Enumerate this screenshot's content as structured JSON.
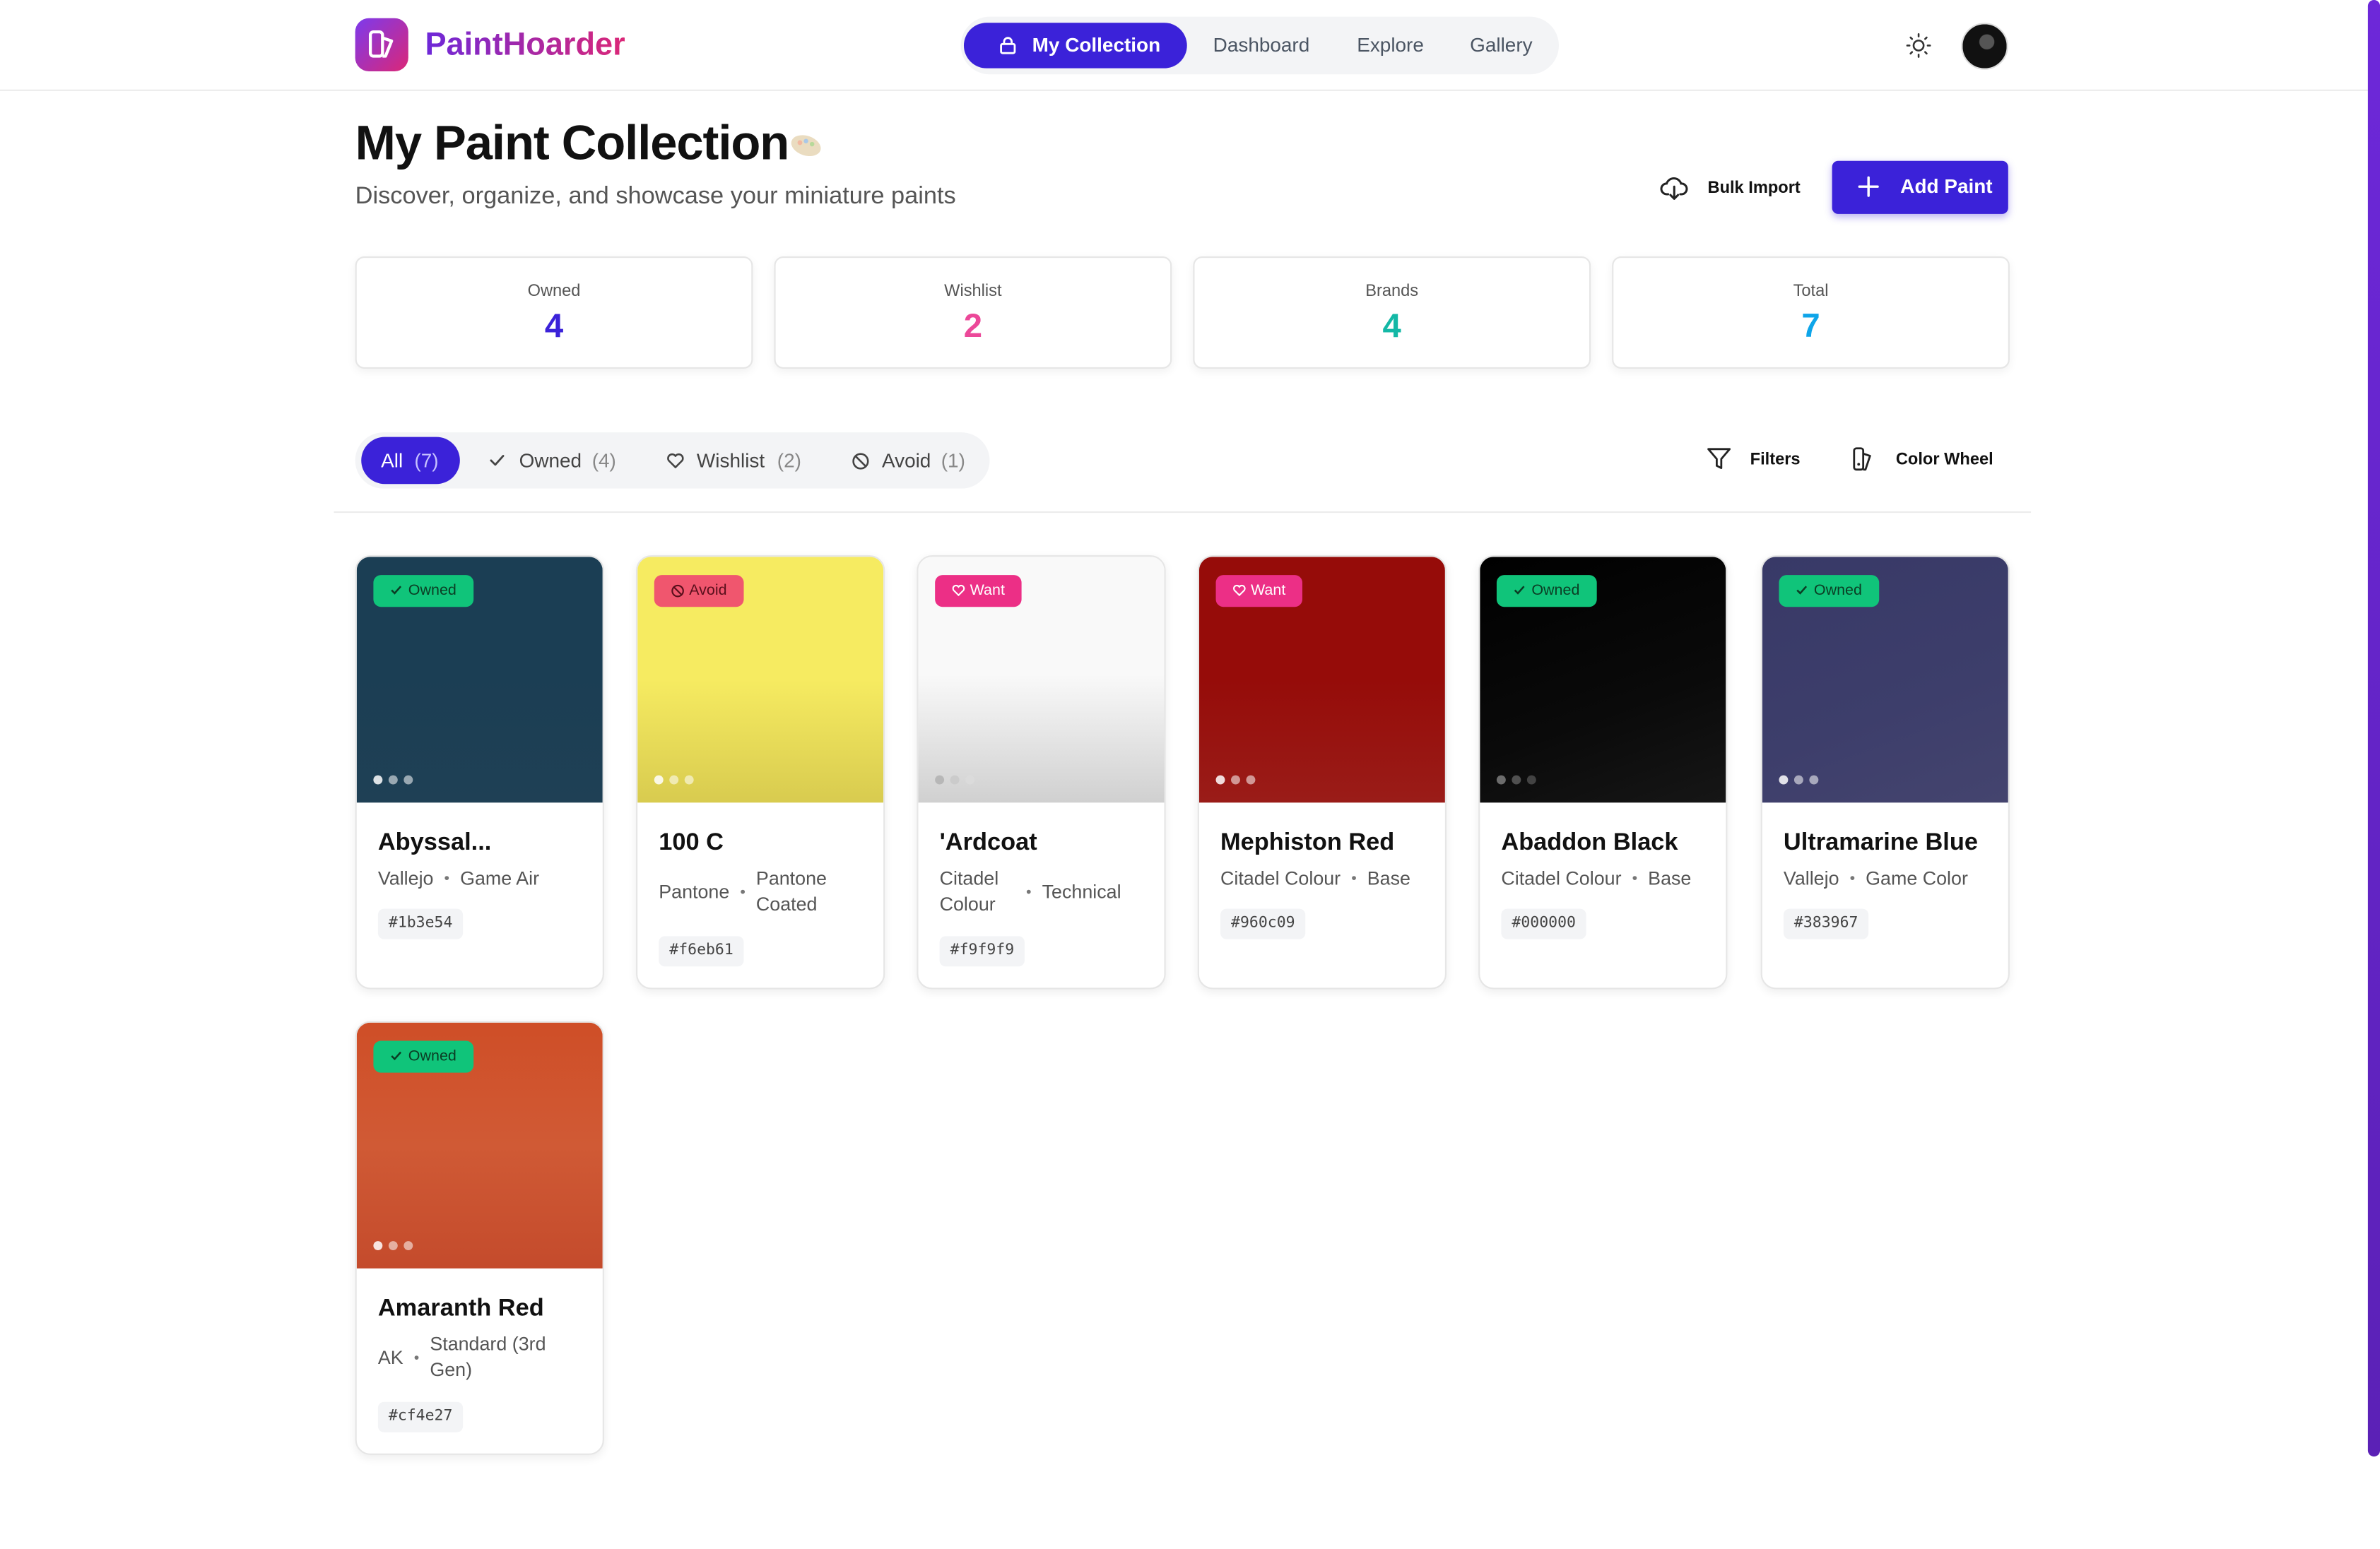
{
  "app": {
    "name": "PaintHoarder"
  },
  "nav": {
    "items": [
      "My Collection",
      "Dashboard",
      "Explore",
      "Gallery"
    ],
    "active": "My Collection"
  },
  "page": {
    "title": "My Paint Collection",
    "subtitle": "Discover, organize, and showcase your miniature paints",
    "bulk_import_label": "Bulk Import",
    "add_paint_label": "Add Paint"
  },
  "stats": [
    {
      "label": "Owned",
      "value": "4",
      "color": "#3b22d9"
    },
    {
      "label": "Wishlist",
      "value": "2",
      "color": "#ec4899"
    },
    {
      "label": "Brands",
      "value": "4",
      "color": "#14b8a6"
    },
    {
      "label": "Total",
      "value": "7",
      "color": "#0ea5e9"
    }
  ],
  "filters": {
    "tabs": [
      {
        "label": "All",
        "count": "(7)"
      },
      {
        "label": "Owned",
        "count": "(4)"
      },
      {
        "label": "Wishlist",
        "count": "(2)"
      },
      {
        "label": "Avoid",
        "count": "(1)"
      }
    ],
    "filters_label": "Filters",
    "color_wheel_label": "Color Wheel"
  },
  "paints": [
    {
      "name": "Abyssal...",
      "brand": "Vallejo",
      "line": "Game Air",
      "hex": "#1b3e54",
      "status": "Owned",
      "color": "#1b3e54"
    },
    {
      "name": "100 C",
      "brand": "Pantone",
      "line": "Pantone Coated",
      "hex": "#f6eb61",
      "status": "Avoid",
      "color": "#f6eb61"
    },
    {
      "name": "'Ardcoat",
      "brand": "Citadel Colour",
      "line": "Technical",
      "hex": "#f9f9f9",
      "status": "Want",
      "color": "#f9f9f9"
    },
    {
      "name": "Mephiston Red",
      "brand": "Citadel Colour",
      "line": "Base",
      "hex": "#960c09",
      "status": "Want",
      "color": "#960c09"
    },
    {
      "name": "Abaddon Black",
      "brand": "Citadel Colour",
      "line": "Base",
      "hex": "#000000",
      "status": "Owned",
      "color": "#000000"
    },
    {
      "name": "Ultramarine Blue",
      "brand": "Vallejo",
      "line": "Game Color",
      "hex": "#383967",
      "status": "Owned",
      "color": "#383967"
    },
    {
      "name": "Amaranth Red",
      "brand": "AK",
      "line": "Standard (3rd Gen)",
      "hex": "#cf4e27",
      "status": "Owned",
      "color": "#cf4e27"
    }
  ]
}
